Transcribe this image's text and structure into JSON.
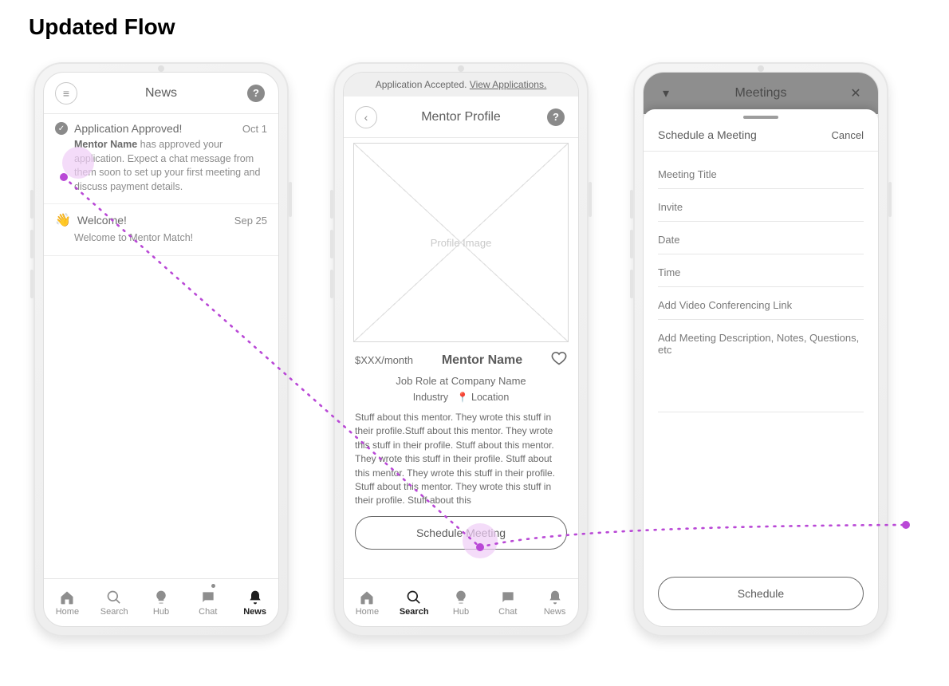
{
  "title": "Updated Flow",
  "tab_labels": {
    "home": "Home",
    "search": "Search",
    "hub": "Hub",
    "chat": "Chat",
    "news": "News"
  },
  "screen1": {
    "nav_title": "News",
    "items": [
      {
        "icon": "check",
        "title": "Application Approved!",
        "date": "Oct 1",
        "body_lead": "Mentor Name",
        "body_rest": " has approved your application. Expect a chat message from them soon to set up your first meeting and discuss payment details."
      },
      {
        "icon": "wave",
        "title": "Welcome!",
        "date": "Sep 25",
        "body_lead": "",
        "body_rest": "Welcome to Mentor Match!"
      }
    ],
    "active_tab": "news"
  },
  "screen2": {
    "banner_text": "Application Accepted. ",
    "banner_link": "View Applications.",
    "nav_title": "Mentor Profile",
    "image_placeholder": "Profile Image",
    "price": "$XXX/month",
    "name": "Mentor Name",
    "role": "Job Role at Company Name",
    "industry": "Industry",
    "location": "Location",
    "bio": "Stuff about this mentor. They wrote this stuff in their profile.Stuff about this mentor. They wrote this stuff in their profile. Stuff about this mentor. They wrote this stuff in their profile. Stuff about this mentor. They wrote this stuff in their profile. Stuff about this mentor. They wrote this stuff in their profile. Stuff about this",
    "cta": "Schedule Meeting",
    "cutoff": "",
    "active_tab": "search"
  },
  "screen3": {
    "nav_title": "Meetings",
    "sheet_title": "Schedule a Meeting",
    "cancel": "Cancel",
    "fields": [
      "Meeting Title",
      "Invite",
      "Date",
      "Time",
      "Add Video Conferencing Link",
      "Add Meeting Description, Notes, Questions, etc"
    ],
    "cta": "Schedule"
  }
}
